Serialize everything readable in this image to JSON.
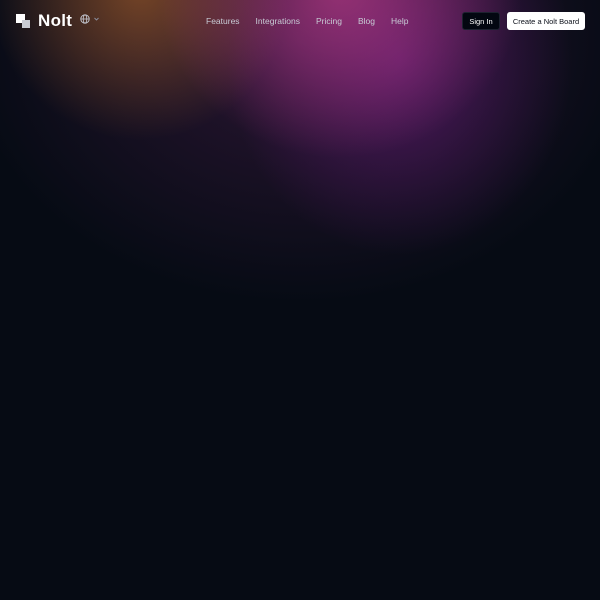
{
  "brand": {
    "name": "Nolt"
  },
  "language": {
    "icon": "globe-icon",
    "dropdown_icon": "chevron-down-icon"
  },
  "nav": {
    "links": [
      {
        "label": "Features"
      },
      {
        "label": "Integrations"
      },
      {
        "label": "Pricing"
      },
      {
        "label": "Blog"
      },
      {
        "label": "Help"
      }
    ]
  },
  "actions": {
    "signin_label": "Sign In",
    "create_label": "Create a Nolt Board"
  },
  "colors": {
    "background": "#060b14",
    "glow_pink": "#dc4696",
    "glow_purple": "#781e8c",
    "glow_orange": "#be6e28",
    "primary_button": "#ffffff",
    "secondary_button": "#030711"
  }
}
